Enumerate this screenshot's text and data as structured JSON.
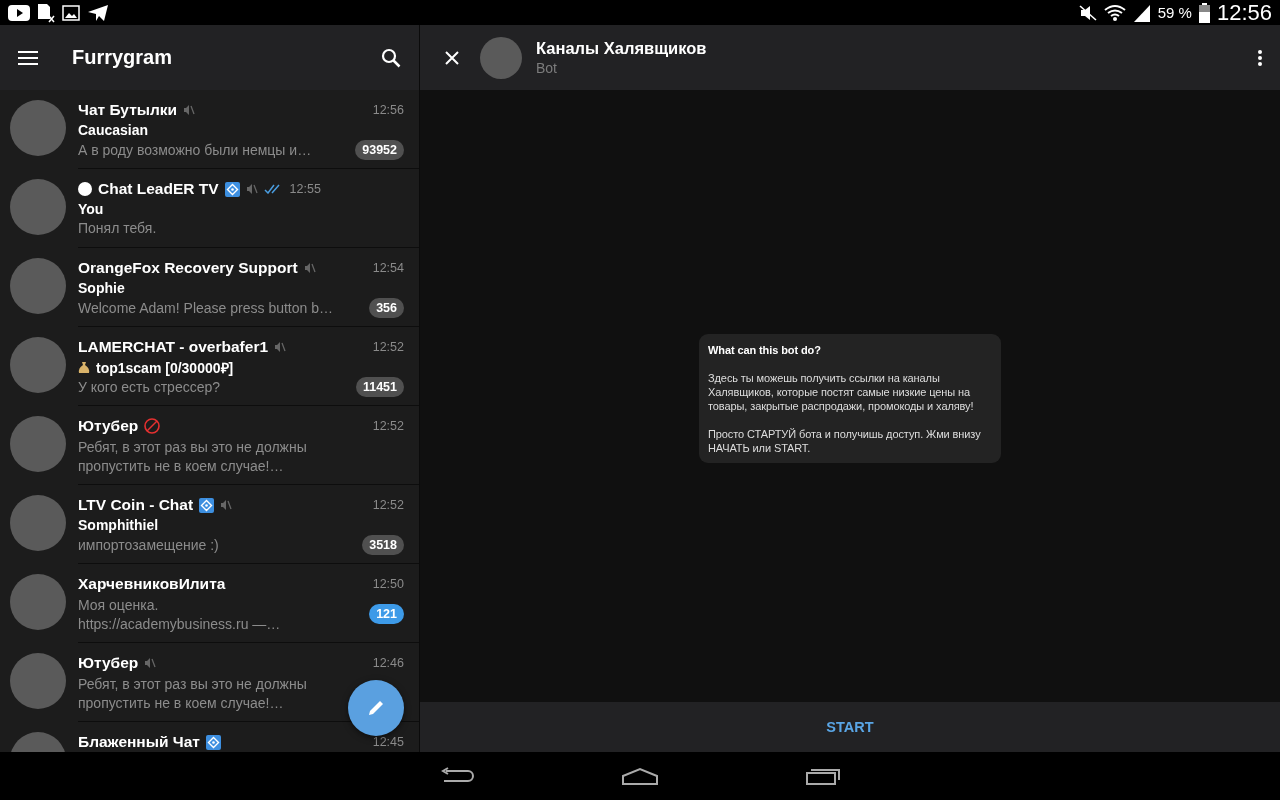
{
  "status_bar": {
    "battery": "59 %",
    "time": "12:56"
  },
  "sidebar": {
    "title": "Furrygram",
    "chats": [
      {
        "title": "Чат Бутылки",
        "title_emoji": false,
        "verified": false,
        "adult": false,
        "muted": true,
        "time": "12:56",
        "read": false,
        "sender": "Caucasian",
        "sender_emoji": false,
        "preview": "А в роду возможно были немцы и…",
        "unread": "93952",
        "unread_muted": true
      },
      {
        "title": "Chat LeadER TV",
        "title_emoji": true,
        "verified": true,
        "adult": false,
        "muted": true,
        "time": "12:55",
        "read": true,
        "sender": "You",
        "sender_emoji": false,
        "preview": "Понял тебя."
      },
      {
        "title": "OrangeFox Recovery Support",
        "title_emoji": false,
        "verified": false,
        "adult": false,
        "muted": true,
        "time": "12:54",
        "read": false,
        "sender": "Sophie",
        "sender_emoji": false,
        "preview": "Welcome Adam! Please press button b…",
        "unread": "356",
        "unread_muted": true
      },
      {
        "title": "LAMERCHAT - overbafer1",
        "title_emoji": false,
        "verified": false,
        "adult": false,
        "muted": true,
        "time": "12:52",
        "read": false,
        "sender": "top1scam [0/30000₽]",
        "sender_emoji": true,
        "preview": "У кого есть стрессер?",
        "unread": "11451",
        "unread_muted": true
      },
      {
        "title": "Ютубер",
        "title_emoji": false,
        "verified": false,
        "adult": true,
        "muted": false,
        "time": "12:52",
        "read": false,
        "preview": "Ребят, в этот раз вы это не должны пропустить не в коем случае!…"
      },
      {
        "title": "LTV Coin - Chat",
        "title_emoji": false,
        "verified": true,
        "adult": false,
        "muted": true,
        "time": "12:52",
        "read": false,
        "sender": "Somphithiel",
        "sender_emoji": false,
        "preview": "импортозамещение :)",
        "unread": "3518",
        "unread_muted": true
      },
      {
        "title": "ХарчевниковИлита",
        "title_emoji": false,
        "verified": false,
        "adult": false,
        "muted": false,
        "time": "12:50",
        "read": false,
        "preview": "Моя оценка.\nhttps://academybusiness.ru  —…",
        "unread": "121",
        "unread_muted": false
      },
      {
        "title": "Ютубер",
        "title_emoji": false,
        "verified": false,
        "adult": false,
        "muted": true,
        "time": "12:46",
        "read": false,
        "preview": "Ребят, в этот раз вы это не должны пропустить не в коем случае!…"
      },
      {
        "title": "Блаженный Чат",
        "title_emoji": false,
        "verified": true,
        "adult": false,
        "muted": false,
        "time": "12:45",
        "read": false
      }
    ]
  },
  "chat": {
    "title": "Каналы Халявщиков",
    "subtitle": "Bot",
    "bot_info": {
      "title": "What can this bot do?",
      "paragraphs": [
        "Здесь ты можешь получить ссылки на каналы Халявщиков, которые постят самые низкие цены на товары, закрытые распродажи, промокоды и халяву!",
        "Просто СТАРТУЙ бота и получишь доступ. Жми внизу НАЧАТЬ или START."
      ]
    },
    "start_button": "START"
  }
}
